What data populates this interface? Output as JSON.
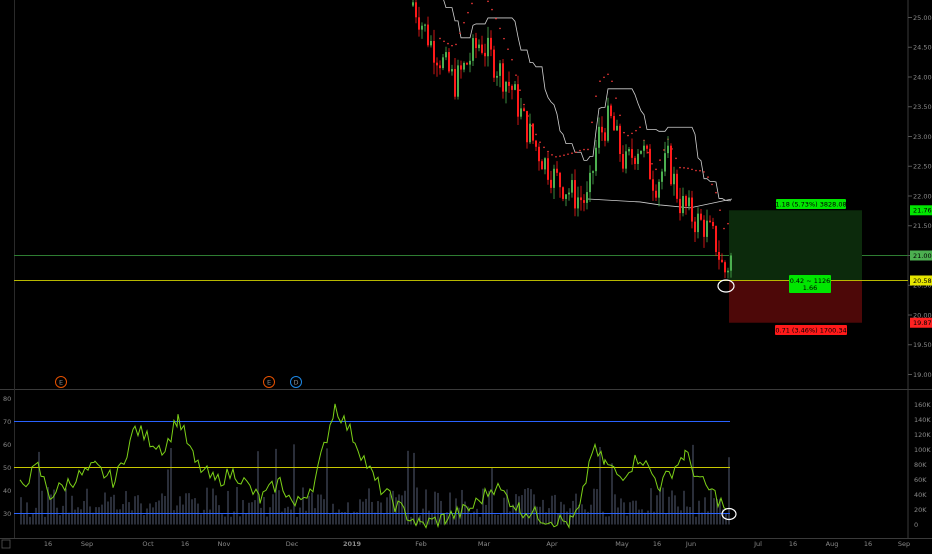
{
  "price_axis": {
    "labels": [
      "25.00",
      "24.50",
      "24.00",
      "23.50",
      "23.00",
      "22.50",
      "22.00",
      "21.50",
      "21.00",
      "20.50",
      "20.00",
      "19.50",
      "19.00"
    ],
    "values": [
      25.0,
      24.5,
      24.0,
      23.5,
      23.0,
      22.5,
      22.0,
      21.5,
      21.0,
      20.5,
      20.0,
      19.5,
      19.0
    ]
  },
  "price_tags": [
    {
      "label": "21.76",
      "value": 21.76,
      "color": "#00e600"
    },
    {
      "label": "21.00",
      "value": 21.0,
      "color": "#4caf50"
    },
    {
      "label": "20.58",
      "value": 20.58,
      "color": "#e6e600"
    },
    {
      "label": "19.87",
      "value": 19.87,
      "color": "#ff2222"
    }
  ],
  "indicator_axis": {
    "labels": [
      "80",
      "70",
      "60",
      "50",
      "40",
      "30"
    ],
    "values": [
      80,
      70,
      60,
      50,
      40,
      30
    ]
  },
  "volume_axis": {
    "labels": [
      "160K",
      "140K",
      "120K",
      "100K",
      "80K",
      "60K",
      "40K",
      "20K",
      "0"
    ],
    "values": [
      160,
      140,
      120,
      100,
      80,
      60,
      40,
      20,
      0
    ]
  },
  "time_axis": {
    "labels": [
      "16",
      "Sep",
      "Oct",
      "16",
      "Nov",
      "Dec",
      "2019",
      "Feb",
      "Mar",
      "Apr",
      "May",
      "16",
      "Jun",
      "Jul",
      "16",
      "Aug",
      "16",
      "Sep"
    ],
    "bold_index": 6
  },
  "position": {
    "target_text": "1.18 (5.73%) 3828.08",
    "center_text_1": "0.42 ~ 1126",
    "center_text_2": "1.66",
    "stop_text": "0.71 (3.46%) 1700.34",
    "entry": 20.58,
    "target": 21.76,
    "stop": 19.87,
    "profit_color": "#00e600",
    "loss_color": "#ff1a1a"
  },
  "events": [
    {
      "label": "E",
      "color": "#e65100"
    },
    {
      "label": "E",
      "color": "#e65100"
    },
    {
      "label": "D",
      "color": "#1e88e5"
    }
  ],
  "indicator_levels": [
    {
      "value": 70,
      "color": "#2962ff"
    },
    {
      "value": 50,
      "color": "#c8c800"
    },
    {
      "value": 30,
      "color": "#2962ff"
    }
  ],
  "colors": {
    "up": "#4caf50",
    "down": "#ff1a1a",
    "rsi": "#7cd117",
    "envelope": "#d0d0d0",
    "psar": "#ff3b3b",
    "volume": "#2a2e39"
  },
  "chart_data": {
    "type": "candlestick",
    "y_range": [
      18.8,
      25.25
    ],
    "series": [
      {
        "type": "candlestick",
        "ohlc": []
      },
      {
        "type": "line",
        "values": []
      }
    ]
  }
}
